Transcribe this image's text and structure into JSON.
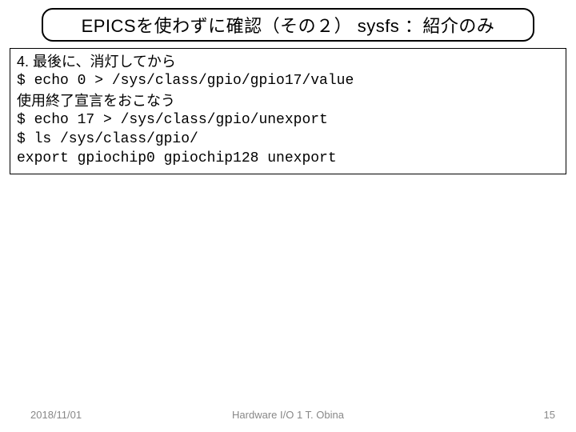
{
  "title": "EPICSを使わずに確認（その２） sysfs ：紹介のみ",
  "content": {
    "step_label": "4. 最後に、消灯してから",
    "cmd1": "$ echo 0 > /sys/class/gpio/gpio17/value",
    "note1": "使用終了宣言をおこなう",
    "cmd2": "$ echo 17 > /sys/class/gpio/unexport",
    "cmd3": "$ ls /sys/class/gpio/",
    "out1": "export gpiochip0 gpiochip128 unexport"
  },
  "footer": {
    "date": "2018/11/01",
    "center": "Hardware I/O 1 T. Obina",
    "page": "15"
  }
}
